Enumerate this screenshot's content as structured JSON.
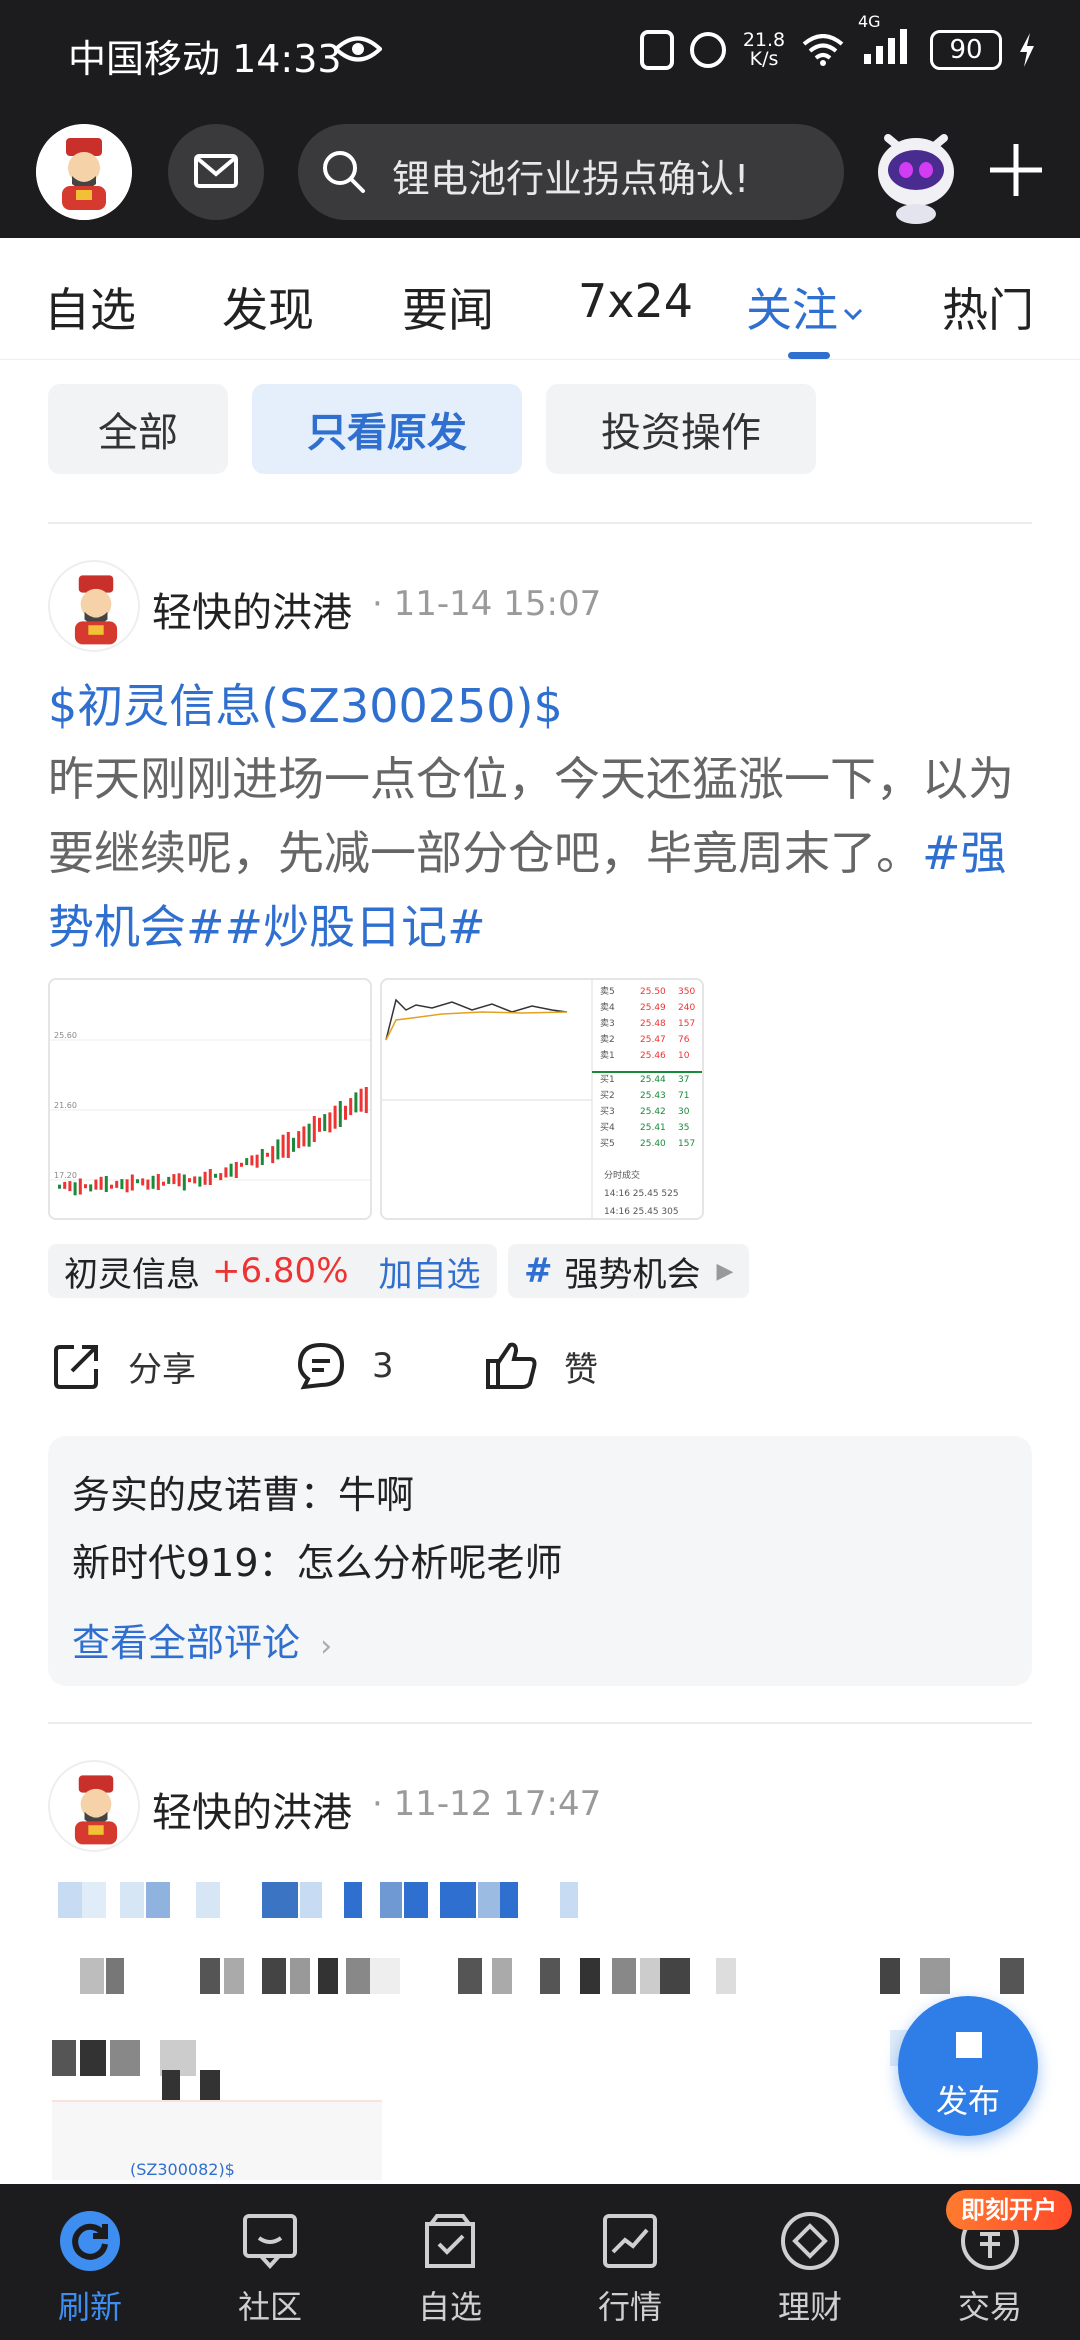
{
  "status_bar": {
    "carrier_time": "中国移动 14:33",
    "net_speed_value": "21.8",
    "net_speed_unit": "K/s",
    "network": "4G",
    "battery": "90"
  },
  "header": {
    "search_placeholder": "锂电池行业拐点确认!"
  },
  "tabs": [
    {
      "label": "自选"
    },
    {
      "label": "发现"
    },
    {
      "label": "要闻"
    },
    {
      "label": "7x24"
    },
    {
      "label": "关注"
    },
    {
      "label": "热门"
    }
  ],
  "filters": [
    {
      "label": "全部"
    },
    {
      "label": "只看原发"
    },
    {
      "label": "投资操作"
    }
  ],
  "post1": {
    "author": "轻快的洪港",
    "time": "· 11-14 15:07",
    "stock": "$初灵信息(SZ300250)$",
    "body": "昨天刚刚进场一点仓位，今天还猛涨一下，以为要继续呢，先减一部分仓吧，毕竟周末了。",
    "tags": "#强势机会##炒股日记#",
    "badge_stock_name": "初灵信息",
    "badge_stock_change": "+6.80%",
    "badge_add": "加自选",
    "badge_topic_hash": "#",
    "badge_topic": "强势机会",
    "share_label": "分享",
    "comment_count": "3",
    "like_label": "赞",
    "comments": [
      {
        "user": "务实的皮诺曹",
        "text": "：牛啊"
      },
      {
        "user": "新时代919",
        "text": "：怎么分析呢老师"
      }
    ],
    "view_all": "查看全部评论",
    "thumb1_labels": {
      "y1": "25.60",
      "y2": "21.60",
      "y3": "17.20"
    },
    "thumb2_rows": [
      [
        "卖5",
        "25.50",
        "350"
      ],
      [
        "卖4",
        "25.49",
        "240"
      ],
      [
        "卖3",
        "25.48",
        "157"
      ],
      [
        "卖2",
        "25.47",
        "76"
      ],
      [
        "卖1",
        "25.46",
        "10"
      ],
      [
        "买1",
        "25.44",
        "37"
      ],
      [
        "买2",
        "25.43",
        "71"
      ],
      [
        "买3",
        "25.42",
        "30"
      ],
      [
        "买4",
        "25.41",
        "35"
      ],
      [
        "买5",
        "25.40",
        "157"
      ]
    ],
    "thumb2_footer": [
      "分时成交",
      "14:16 25.45 525",
      "14:16 25.45 305"
    ]
  },
  "post2": {
    "author": "轻快的洪港",
    "time": "· 11-12 17:47",
    "stock_fragment": "(SZ300082)$"
  },
  "fab": {
    "label": "发布"
  },
  "promo": "即刻开户",
  "bottom_nav": [
    {
      "label": "刷新",
      "icon": "refresh-icon"
    },
    {
      "label": "社区",
      "icon": "community-icon"
    },
    {
      "label": "自选",
      "icon": "watchlist-icon"
    },
    {
      "label": "行情",
      "icon": "market-icon"
    },
    {
      "label": "理财",
      "icon": "finance-icon"
    },
    {
      "label": "交易",
      "icon": "trade-icon"
    }
  ],
  "colors": {
    "accent": "#2f6fcf",
    "up": "#ee3333",
    "dark_bar": "#1c1c1e"
  }
}
